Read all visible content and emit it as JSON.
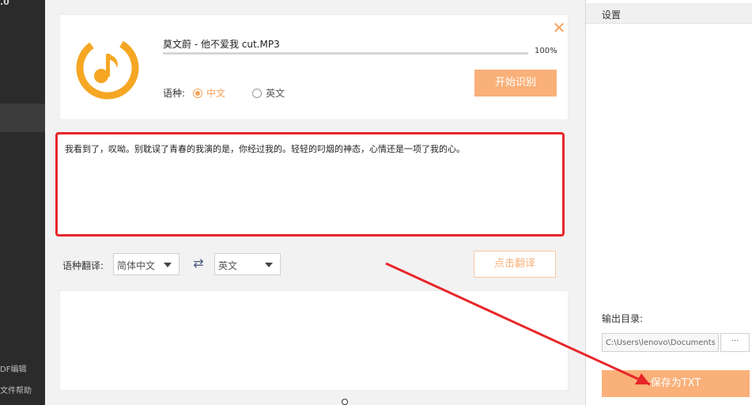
{
  "sidebar": {
    "top_fragment": ".0",
    "bottom_items": [
      "DF编辑",
      "文件帮助"
    ]
  },
  "file_card": {
    "file_name": "莫文蔚 - 他不爱我 cut.MP3",
    "progress_text": "100%",
    "progress_value": 1.0,
    "language_label": "语种:",
    "language_options": [
      "中文",
      "英文"
    ],
    "selected_language": "中文",
    "start_button": "开始识别",
    "close_icon": "close-icon"
  },
  "recognized_text": "我看到了，叹呦。别耽误了青春的我演的是，你经过我的。轻轻的叼烟的神态，心情还是一项了我的心。",
  "translation": {
    "label": "语种翻译:",
    "source_lang": "简体中文",
    "target_lang": "英文",
    "swap_icon": "swap-arrows-icon",
    "translate_button": "点击翻译"
  },
  "settings": {
    "title": "设置",
    "output_dir_label": "输出目录:",
    "output_path": "C:\\Users\\lenovo\\Documents\\",
    "browse_button": "···",
    "save_button": "保存为TXT"
  },
  "colors": {
    "accent": "#f9b079",
    "annotation": "#e8262a",
    "sidebar": "#2b2b2b"
  }
}
